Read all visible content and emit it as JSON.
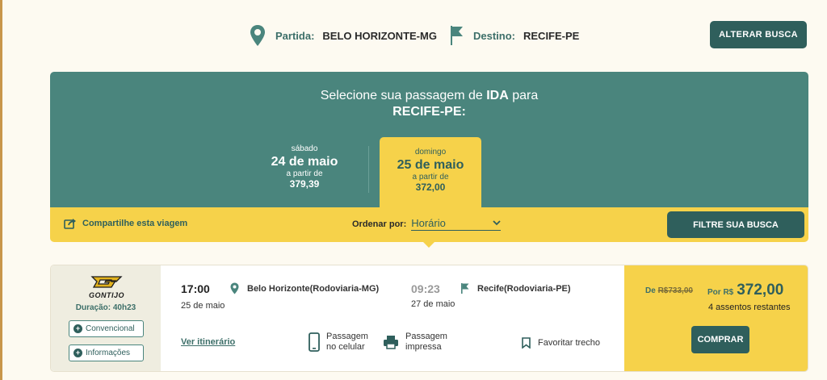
{
  "search": {
    "origin_label": "Partida:",
    "origin_value": "BELO HORIZONTE-MG",
    "destination_label": "Destino:",
    "destination_value": "RECIFE-PE",
    "change_button": "ALTERAR BUSCA"
  },
  "header": {
    "headline_prefix": "Selecione sua passagem de",
    "headline_dir": "IDA",
    "headline_suffix": "para",
    "headline_city": "RECIFE-PE:"
  },
  "dates": [
    {
      "weekday": "sábado",
      "date": "24 de maio",
      "from_label": "a partir de",
      "price": "379,39",
      "selected": false
    },
    {
      "weekday": "domingo",
      "date": "25 de maio",
      "from_label": "a partir de",
      "price": "372,00",
      "selected": true
    }
  ],
  "toolbar": {
    "share_label": "Compartilhe esta viagem",
    "order_label": "Ordenar por:",
    "order_value": "Horário",
    "filter_button": "FILTRE SUA BUSCA"
  },
  "result": {
    "company": "GONTIJO",
    "duration": "Duração: 40h23",
    "class_label": "Convencional",
    "info_label": "Informações",
    "departure_time": "17:00",
    "departure_date": "25 de maio",
    "departure_place": "Belo Horizonte(Rodoviaria-MG)",
    "arrival_time": "09:23",
    "arrival_date": "27 de maio",
    "arrival_place": "Recife(Rodoviaria-PE)",
    "itinerary_link": "Ver itinerário",
    "feature_mobile_1": "Passagem",
    "feature_mobile_2": "no celular",
    "feature_print_1": "Passagem",
    "feature_print_2": "impressa",
    "favorite_label": "Favoritar trecho",
    "old_price_prefix": "De",
    "old_price": "R$733,00",
    "price_prefix": "Por R$",
    "price": "372,00",
    "seats": "4 assentos restantes",
    "buy_button": "COMPRAR"
  },
  "colors": {
    "primary": "#2f5f5c",
    "header_green": "#4a857d",
    "accent_yellow": "#f6d24a",
    "background": "#fdfaf1"
  }
}
